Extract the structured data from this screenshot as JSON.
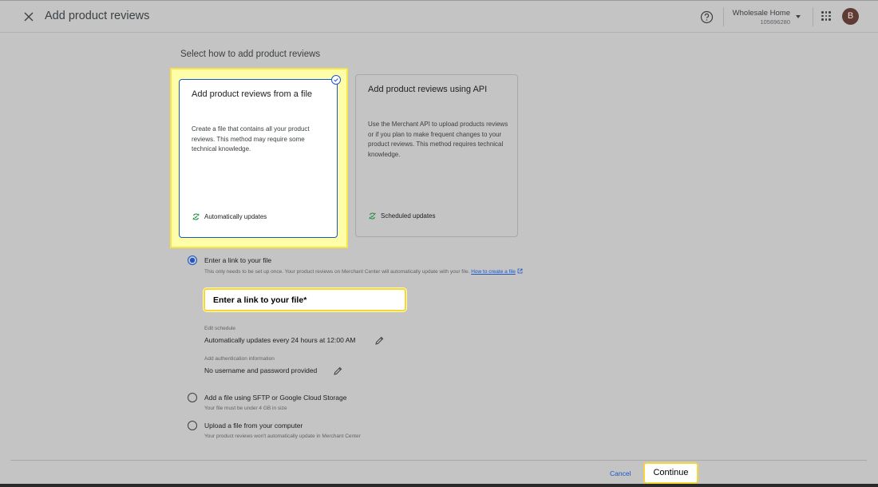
{
  "header": {
    "title": "Add product reviews",
    "account_name": "Wholesale Home",
    "account_id": "105696280",
    "avatar_letter": "B"
  },
  "section_label": "Select how to add product reviews",
  "cards": {
    "file": {
      "title": "Add product reviews from a file",
      "description": "Create a file that contains all your product reviews. This method may require some technical knowledge.",
      "footer": "Automatically updates"
    },
    "api": {
      "title": "Add product reviews using API",
      "description": "Use the Merchant API to upload products reviews or if you plan to make frequent changes to your product reviews. This method requires technical knowledge.",
      "footer": "Scheduled updates"
    }
  },
  "options": {
    "link": {
      "title": "Enter a link to your file",
      "subtitle": "This only needs to be set up once. Your product reviews on Merchant Center will automatically update with your file.",
      "help_link": "How to create a file",
      "field_label": "Enter a link to your file*",
      "selected": true
    },
    "schedule": {
      "caption": "Edit schedule",
      "value": "Automatically updates every 24 hours at 12:00 AM"
    },
    "auth": {
      "caption": "Add authentication information",
      "value": "No username and password provided"
    },
    "sftp": {
      "title": "Add a file using SFTP or Google Cloud Storage",
      "subtitle": "Your file must be under 4 GB in size",
      "selected": false
    },
    "upload": {
      "title": "Upload a file from your computer",
      "subtitle": "Your product reviews won't automatically update in Merchant Center",
      "selected": false
    }
  },
  "footer": {
    "cancel_label": "Cancel",
    "continue_label": "Continue"
  },
  "colors": {
    "accent": "#1a56c9",
    "highlight": "#f6e349",
    "success": "#1e8e3e"
  }
}
